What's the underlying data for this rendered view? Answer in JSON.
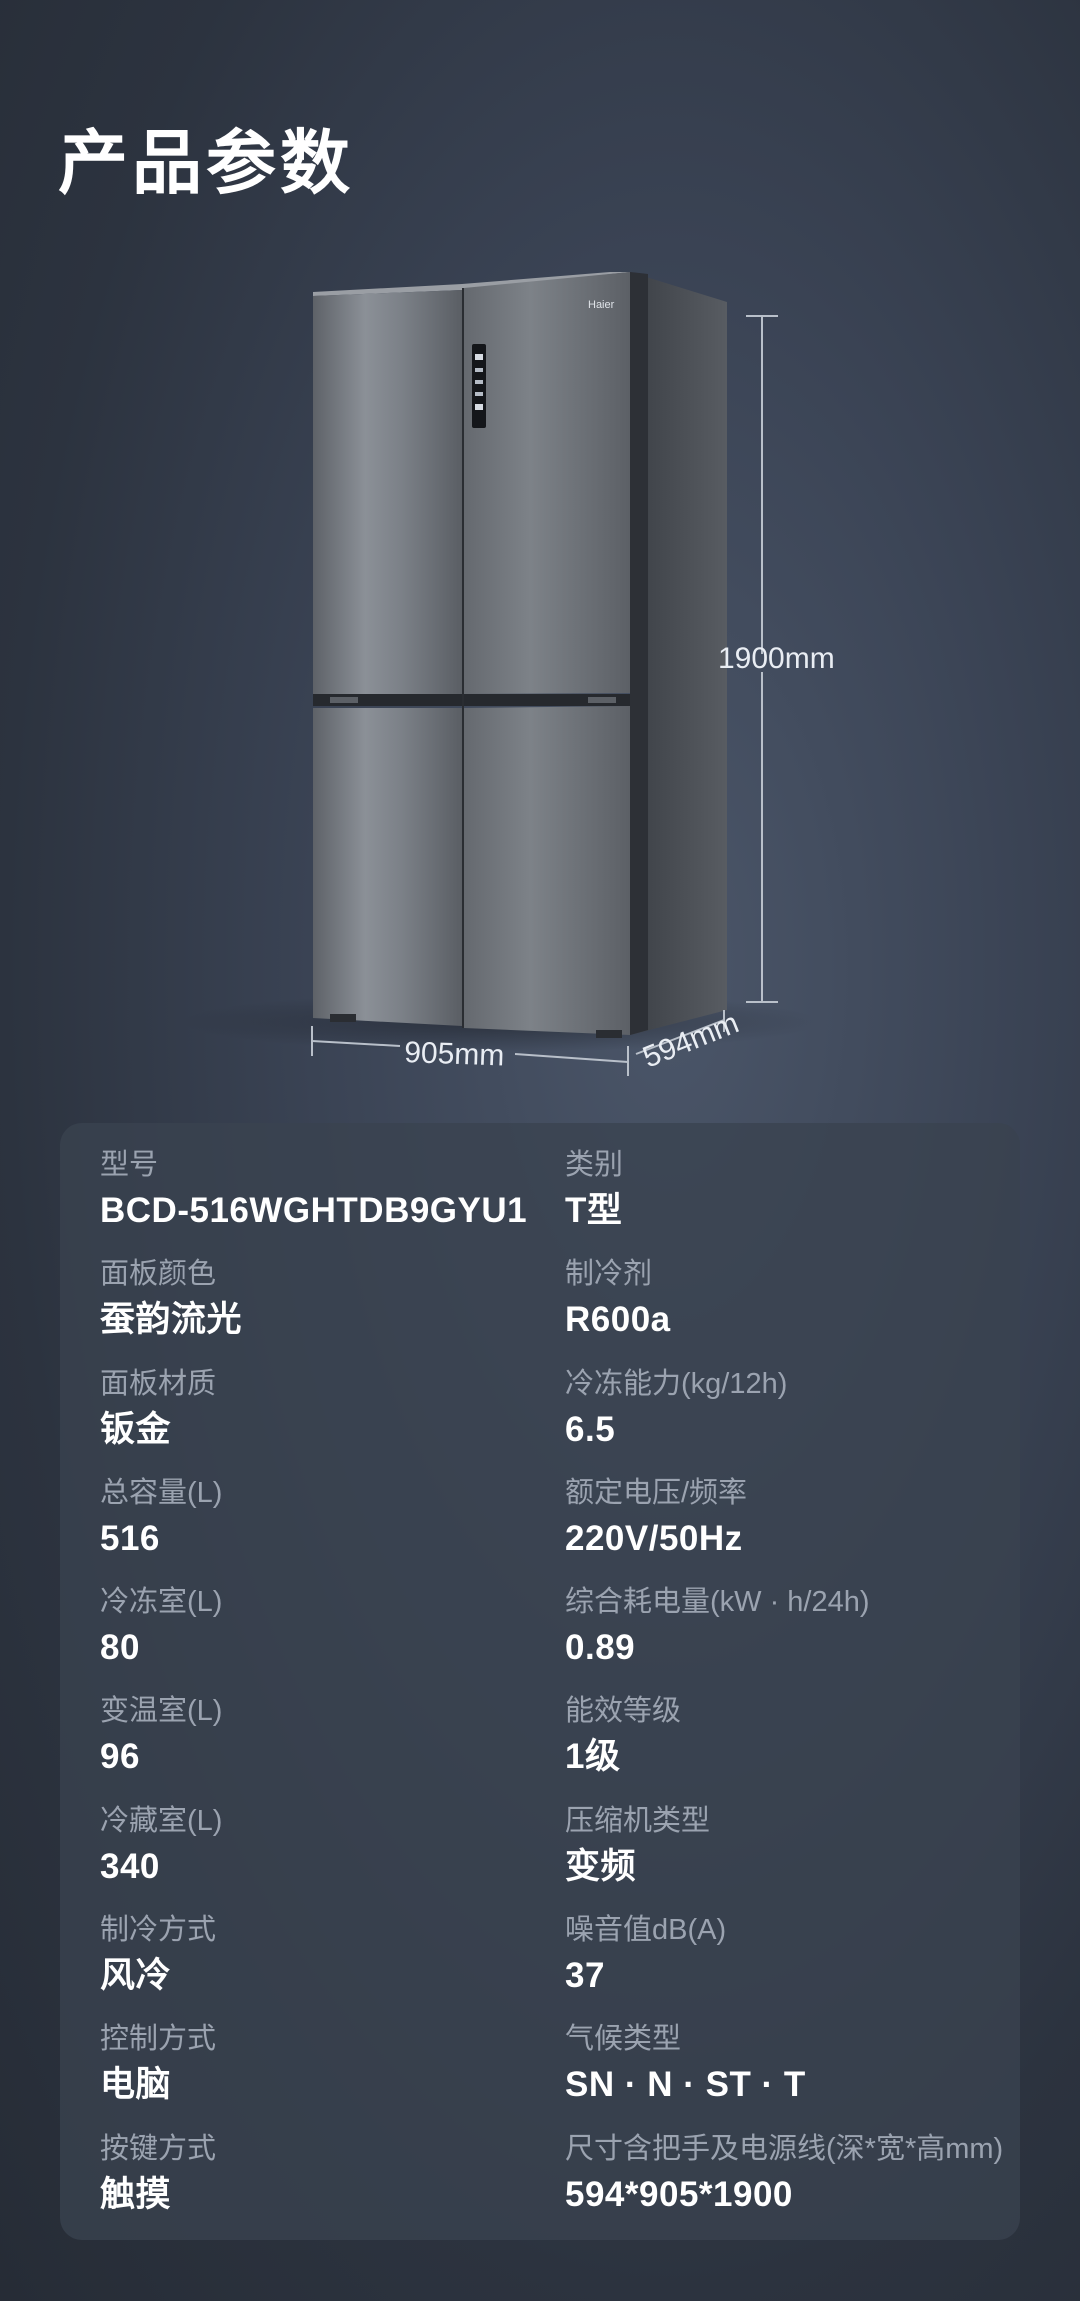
{
  "page": {
    "title": "产品参数"
  },
  "product": {
    "brand": "Haier",
    "dimensions": {
      "height": "1900mm",
      "width": "905mm",
      "depth": "594mm"
    }
  },
  "specs": [
    {
      "label": "型号",
      "value": "BCD-516WGHTDB9GYU1"
    },
    {
      "label": "类别",
      "value": "T型"
    },
    {
      "label": "面板颜色",
      "value": "蚕韵流光"
    },
    {
      "label": "制冷剂",
      "value": "R600a"
    },
    {
      "label": "面板材质",
      "value": "钣金"
    },
    {
      "label": "冷冻能力(kg/12h)",
      "value": "6.5"
    },
    {
      "label": "总容量(L)",
      "value": "516"
    },
    {
      "label": "额定电压/频率",
      "value": "220V/50Hz"
    },
    {
      "label": "冷冻室(L)",
      "value": "80"
    },
    {
      "label": "综合耗电量(kW · h/24h)",
      "value": "0.89"
    },
    {
      "label": "变温室(L)",
      "value": "96"
    },
    {
      "label": "能效等级",
      "value": "1级"
    },
    {
      "label": "冷藏室(L)",
      "value": "340"
    },
    {
      "label": "压缩机类型",
      "value": "变频"
    },
    {
      "label": "制冷方式",
      "value": "风冷"
    },
    {
      "label": "噪音值dB(A)",
      "value": "37"
    },
    {
      "label": "控制方式",
      "value": "电脑"
    },
    {
      "label": "气候类型",
      "value": "SN · N · ST · T"
    },
    {
      "label": "按键方式",
      "value": "触摸"
    },
    {
      "label": "尺寸含把手及电源线(深*宽*高mm)",
      "value": "594*905*1900"
    }
  ]
}
